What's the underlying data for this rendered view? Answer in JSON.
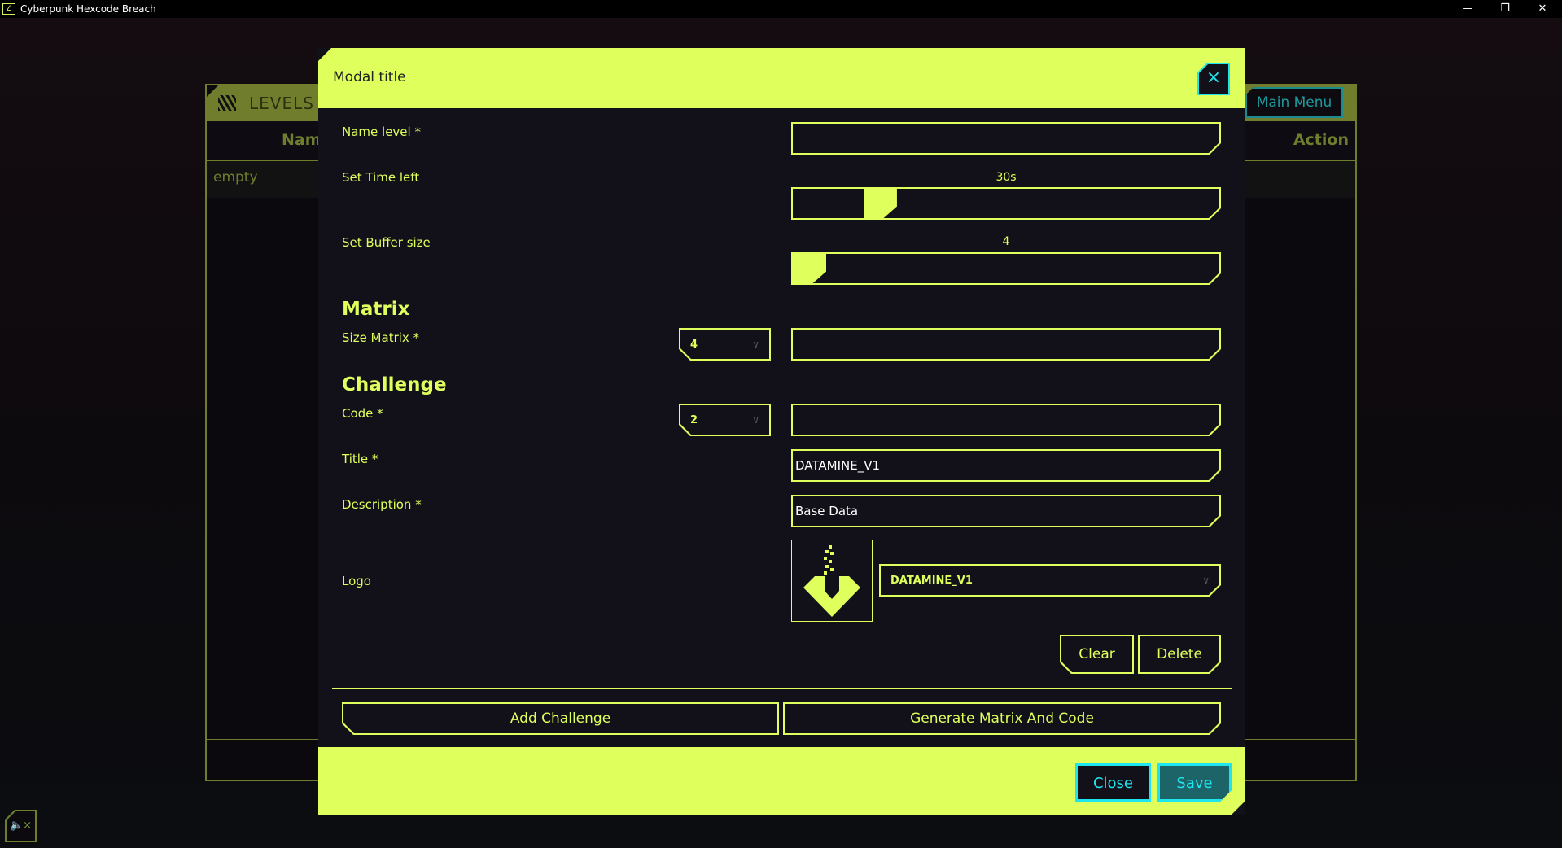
{
  "window": {
    "title": "Cyberpunk Hexcode Breach",
    "minimize": "—",
    "restore": "❐",
    "close": "✕"
  },
  "levels": {
    "title": "LEVELS",
    "columns": [
      "Name",
      "Action"
    ],
    "empty_text": "empty",
    "main_menu": "Main Menu"
  },
  "mute_icon": "🔈×",
  "modal": {
    "title": "Modal title",
    "close_icon": "×",
    "name_level": {
      "label": "Name level *",
      "value": ""
    },
    "time_left": {
      "label": "Set Time left",
      "value_text": "30s",
      "fraction": 0.18
    },
    "buffer_size": {
      "label": "Set Buffer size",
      "value_text": "4",
      "fraction": 0.0
    },
    "matrix": {
      "heading": "Matrix",
      "size_label": "Size Matrix *",
      "size_value": "4",
      "matrix_value": ""
    },
    "challenge": {
      "heading": "Challenge",
      "code_label": "Code *",
      "code_value": "2",
      "code_input": "",
      "title_label": "Title *",
      "title_value": "DATAMINE_V1",
      "description_label": "Description *",
      "description_value": "Base Data",
      "logo_label": "Logo",
      "logo_value": "DATAMINE_V1",
      "clear": "Clear",
      "delete": "Delete"
    },
    "add_challenge": "Add Challenge",
    "generate": "Generate Matrix And Code",
    "close": "Close",
    "save": "Save"
  },
  "colors": {
    "accent": "#deff5c",
    "cyan": "#1ee6f0",
    "panel": "#121019",
    "olive": "#6f7d2d"
  }
}
